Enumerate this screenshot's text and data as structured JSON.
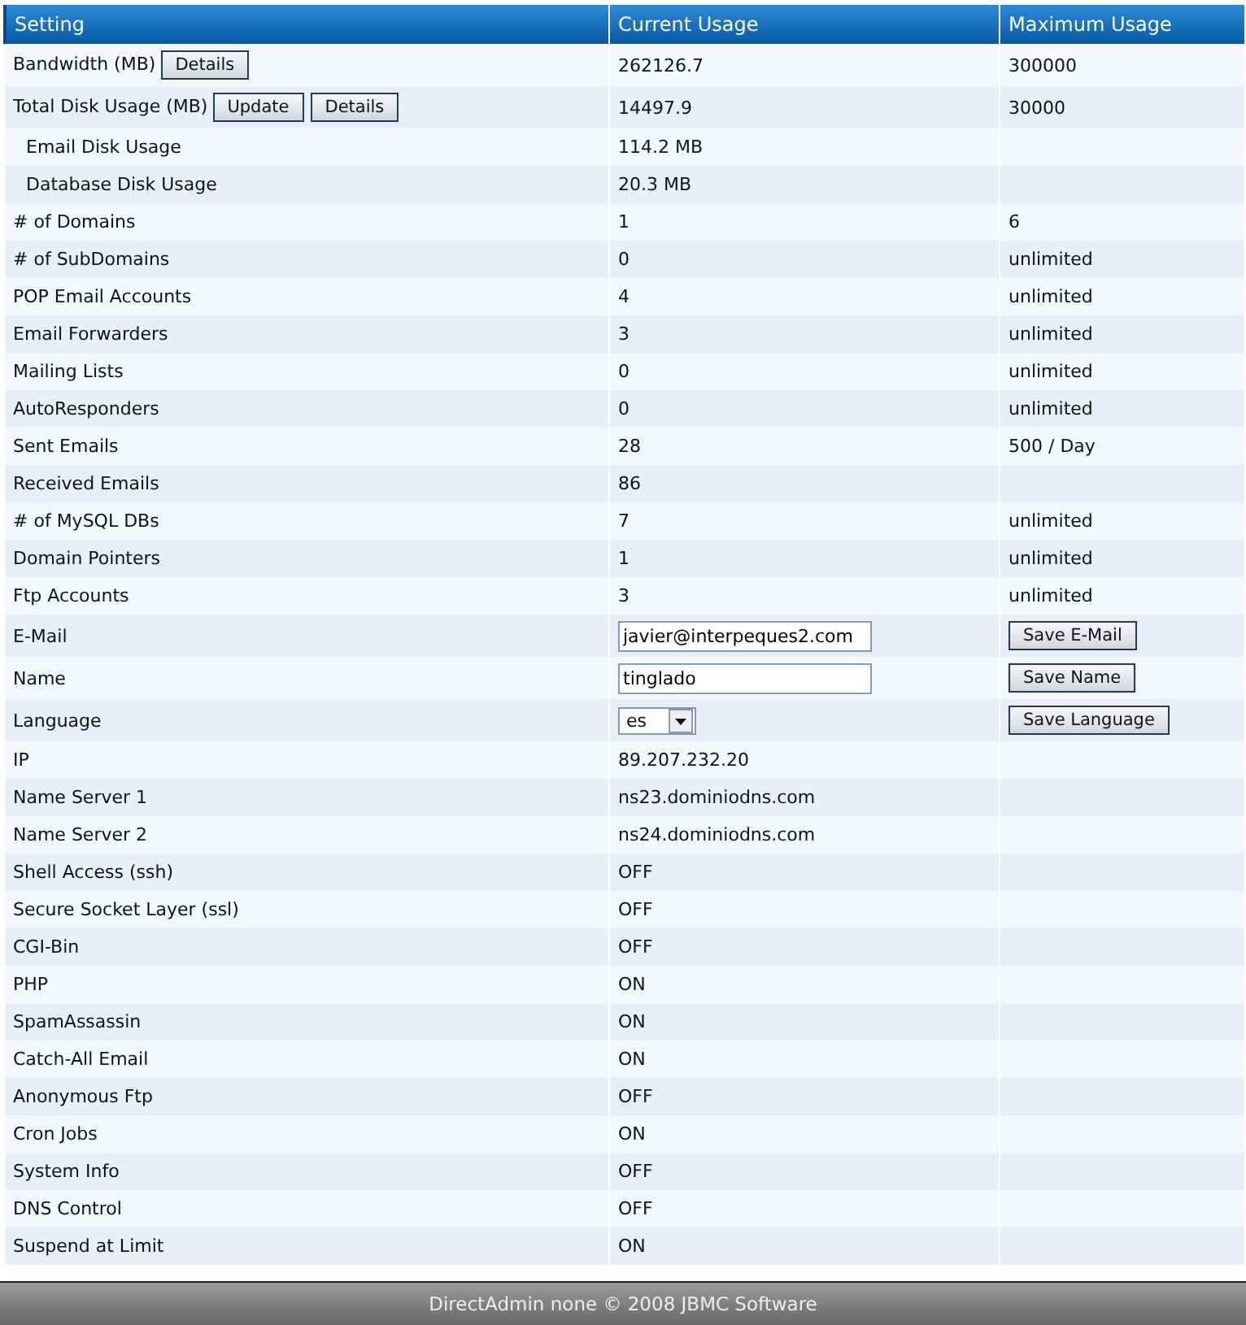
{
  "table": {
    "columns": [
      "Setting",
      "Current Usage",
      "Maximum Usage"
    ],
    "rows": [
      {
        "kind": "stat",
        "setting": "Bandwidth (MB)",
        "buttons": [
          "Details"
        ],
        "current": "262126.7",
        "maximum": "300000"
      },
      {
        "kind": "stat",
        "setting": "Total Disk Usage (MB)",
        "buttons": [
          "Update",
          "Details"
        ],
        "current": "14497.9",
        "maximum": "30000",
        "children": [
          {
            "kind": "stat",
            "setting": "Email Disk Usage",
            "current": "114.2 MB"
          },
          {
            "kind": "stat",
            "setting": "Database Disk Usage",
            "current": "20.3 MB"
          }
        ]
      },
      {
        "kind": "stat",
        "setting": "# of Domains",
        "current": "1",
        "maximum": "6"
      },
      {
        "kind": "stat",
        "setting": "# of SubDomains",
        "current": "0",
        "maximum": "unlimited"
      },
      {
        "kind": "stat",
        "setting": "POP Email Accounts",
        "current": "4",
        "maximum": "unlimited"
      },
      {
        "kind": "stat",
        "setting": "Email Forwarders",
        "current": "3",
        "maximum": "unlimited"
      },
      {
        "kind": "stat",
        "setting": "Mailing Lists",
        "current": "0",
        "maximum": "unlimited"
      },
      {
        "kind": "stat",
        "setting": "AutoResponders",
        "current": "0",
        "maximum": "unlimited"
      },
      {
        "kind": "stat",
        "setting": "Sent Emails",
        "current": "28",
        "maximum": "500 / Day"
      },
      {
        "kind": "stat",
        "setting": "Received Emails",
        "current": "86"
      },
      {
        "kind": "stat",
        "setting": "# of MySQL DBs",
        "current": "7",
        "maximum": "unlimited"
      },
      {
        "kind": "stat",
        "setting": "Domain Pointers",
        "current": "1",
        "maximum": "unlimited"
      },
      {
        "kind": "stat",
        "setting": "Ftp Accounts",
        "current": "3",
        "maximum": "unlimited"
      },
      {
        "kind": "input",
        "setting": "E-Mail",
        "value": "javier@interpeques2.com",
        "button": "Save E-Mail"
      },
      {
        "kind": "input",
        "setting": "Name",
        "value": "tinglado",
        "button": "Save Name"
      },
      {
        "kind": "select",
        "setting": "Language",
        "value": "es",
        "button": "Save Language"
      },
      {
        "kind": "stat",
        "setting": "IP",
        "current": "89.207.232.20"
      },
      {
        "kind": "stat",
        "setting": "Name Server 1",
        "current": "ns23.dominiodns.com"
      },
      {
        "kind": "stat",
        "setting": "Name Server 2",
        "current": "ns24.dominiodns.com"
      },
      {
        "kind": "stat",
        "setting": "Shell Access (ssh)",
        "current": "OFF"
      },
      {
        "kind": "stat",
        "setting": "Secure Socket Layer (ssl)",
        "current": "OFF"
      },
      {
        "kind": "stat",
        "setting": "CGI-Bin",
        "current": "OFF"
      },
      {
        "kind": "stat",
        "setting": "PHP",
        "current": "ON"
      },
      {
        "kind": "stat",
        "setting": "SpamAssassin",
        "current": "ON"
      },
      {
        "kind": "stat",
        "setting": "Catch-All Email",
        "current": "ON"
      },
      {
        "kind": "stat",
        "setting": "Anonymous Ftp",
        "current": "OFF"
      },
      {
        "kind": "stat",
        "setting": "Cron Jobs",
        "current": "ON"
      },
      {
        "kind": "stat",
        "setting": "System Info",
        "current": "OFF"
      },
      {
        "kind": "stat",
        "setting": "DNS Control",
        "current": "OFF"
      },
      {
        "kind": "stat",
        "setting": "Suspend at Limit",
        "current": "ON"
      }
    ]
  },
  "footer": "DirectAdmin none © 2008 JBMC Software"
}
